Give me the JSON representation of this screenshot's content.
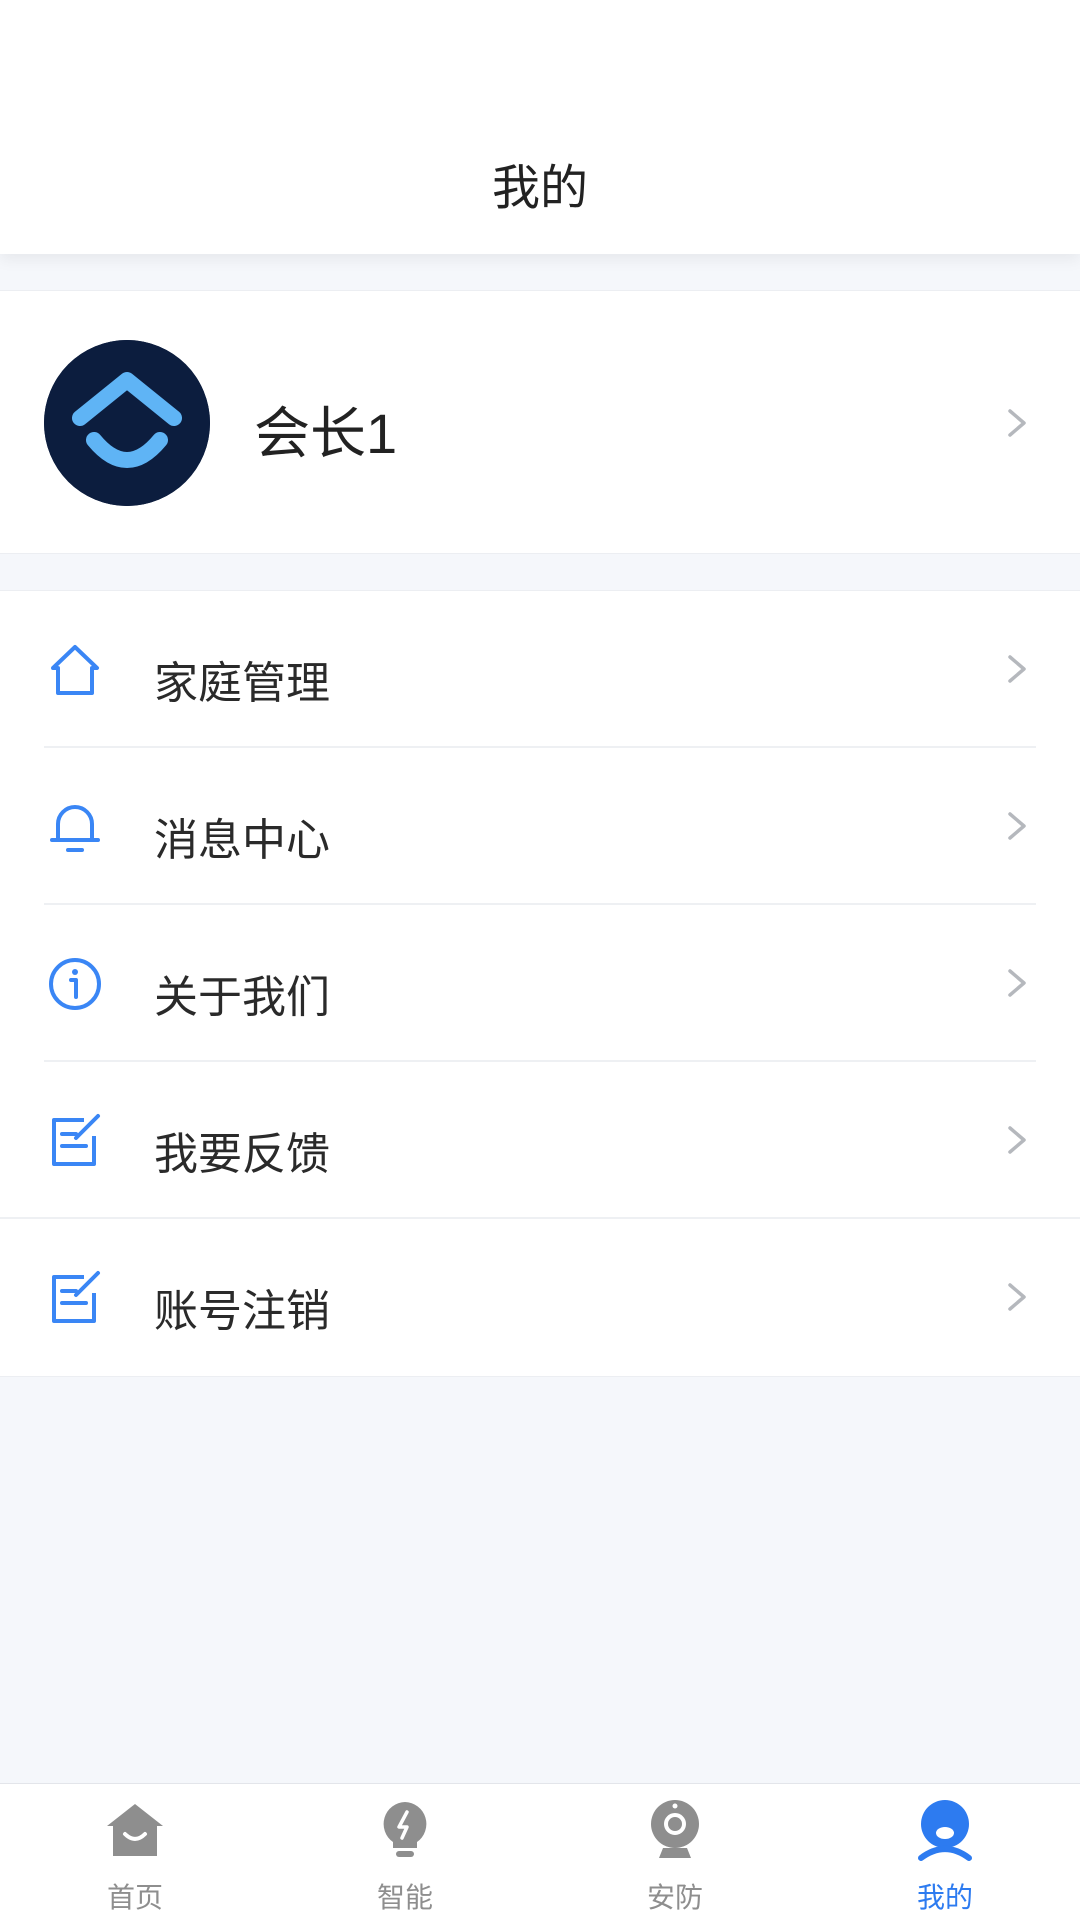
{
  "header": {
    "title": "我的"
  },
  "profile": {
    "name": "会长1"
  },
  "menu": {
    "items": [
      {
        "label": "家庭管理",
        "icon": "home-outline-icon"
      },
      {
        "label": "消息中心",
        "icon": "bell-icon"
      },
      {
        "label": "关于我们",
        "icon": "info-icon"
      },
      {
        "label": "我要反馈",
        "icon": "edit-note-icon"
      },
      {
        "label": "账号注销",
        "icon": "edit-note-icon"
      }
    ]
  },
  "tabbar": {
    "tabs": [
      {
        "label": "首页",
        "icon": "home-icon",
        "active": false
      },
      {
        "label": "智能",
        "icon": "bulb-icon",
        "active": false
      },
      {
        "label": "安防",
        "icon": "camera-icon",
        "active": false
      },
      {
        "label": "我的",
        "icon": "person-icon",
        "active": true
      }
    ]
  },
  "colors": {
    "accent": "#2d7bf0",
    "icon_blue": "#3a86f5",
    "avatar_bg": "#0c1d3e",
    "avatar_logo": "#5fb4f5",
    "tab_inactive": "#8e8e8e",
    "page_bg": "#f5f7fb"
  }
}
